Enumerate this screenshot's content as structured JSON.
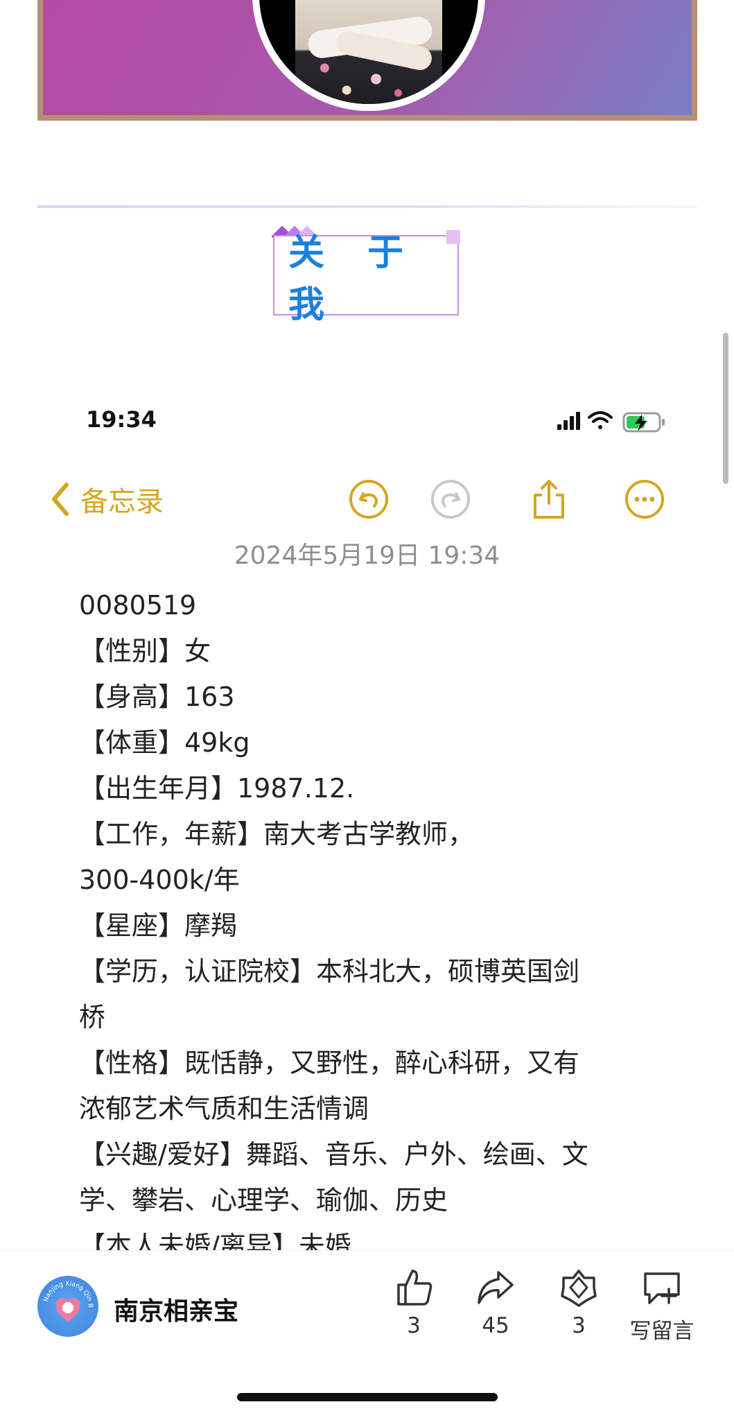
{
  "about_title": "关 于 我",
  "notes_screen": {
    "status_time": "19:34",
    "back_label": "备忘录",
    "date": "2024年5月19日 19:34",
    "lines": [
      "0080519",
      "【性别】女",
      "【身高】163",
      "【体重】49kg",
      "【出生年月】1987.12.",
      "【工作，年薪】南大考古学教师，",
      "300-400k/年",
      "【星座】摩羯",
      "【学历，认证院校】本科北大，硕博英国剑",
      "桥",
      "【性格】既恬静，又野性，醉心科研，又有",
      "浓郁艺术气质和生活情调",
      "【兴趣/爱好】舞蹈、音乐、户外、绘画、文",
      "学、攀岩、心理学、瑜伽、历史",
      "【本人未婚/离异】未婚"
    ]
  },
  "account": {
    "name": "南京相亲宝",
    "logo_text": "Nanjing Xiang Qin Bao"
  },
  "actions": {
    "like_count": "3",
    "share_count": "45",
    "favorite_count": "3",
    "comment_label": "写留言"
  },
  "colors": {
    "accent_blue": "#1a7fe0",
    "notes_yellow": "#d6a520",
    "banner_border": "#b98f73"
  },
  "icons": [
    "back-chevron-icon",
    "undo-icon",
    "redo-icon",
    "share-up-icon",
    "more-icon",
    "thumbs-up-icon",
    "forward-icon",
    "favorite-icon",
    "comment-icon"
  ]
}
